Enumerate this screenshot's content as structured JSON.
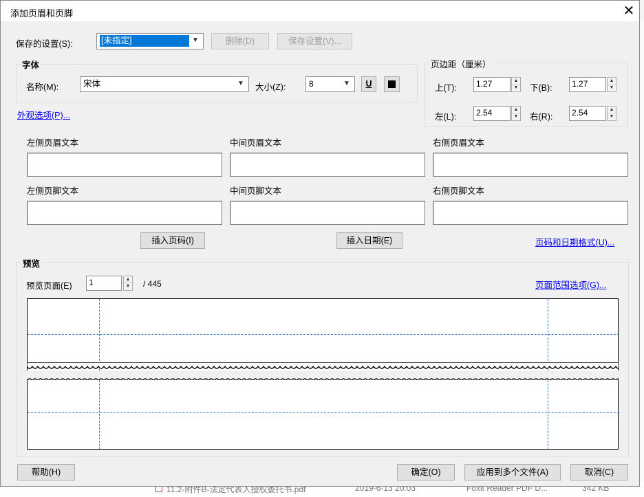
{
  "dialog": {
    "title": "添加页眉和页脚",
    "close_glyph": "✕"
  },
  "saved_settings": {
    "label": "保存的设置(S):",
    "value": "[未指定]",
    "delete_label": "删除(D)",
    "save_label": "保存设置(V)..."
  },
  "font": {
    "group_title": "字体",
    "name_label": "名称(M):",
    "name_value": "宋体",
    "size_label": "大小(Z):",
    "size_value": "8",
    "underline_glyph": "U"
  },
  "appearance_link": "外观选项(P)...",
  "margins": {
    "group_title": "页边距（厘米）",
    "top_label": "上(T):",
    "top_value": "1.27",
    "bottom_label": "下(B):",
    "bottom_value": "1.27",
    "left_label": "左(L):",
    "left_value": "2.54",
    "right_label": "右(R):",
    "right_value": "2.54"
  },
  "header_footer": {
    "left_header_label": "左侧页眉文本",
    "center_header_label": "中间页眉文本",
    "right_header_label": "右侧页眉文本",
    "left_footer_label": "左侧页脚文本",
    "center_footer_label": "中间页脚文本",
    "right_footer_label": "右侧页脚文本",
    "insert_page_label": "插入页码(I)",
    "insert_date_label": "插入日期(E)",
    "format_link": "页码和日期格式(U)..."
  },
  "preview": {
    "group_title": "预览",
    "page_label": "预览页面(E)",
    "page_value": "1",
    "total": "/ 445",
    "range_link": "页面范围选项(G)..."
  },
  "footer_buttons": {
    "help": "帮助(H)",
    "ok": "确定(O)",
    "apply_multiple": "应用到多个文件(A)",
    "cancel": "取消(C)"
  },
  "background": {
    "file_name": "11.2-附件B-法定代表人授权委托书.pdf",
    "file_date": "2019-6-13 20:03",
    "file_type": "Foxit Reader PDF D...",
    "file_size": "342 KB"
  },
  "colors": {
    "accent_selection": "#0078d7",
    "link": "#0000ee",
    "guide_line": "#3b78c9"
  },
  "icons": {
    "dropdown": "chevron-down-icon",
    "spin_up": "triangle-up-icon",
    "spin_down": "triangle-down-icon",
    "close": "close-icon",
    "color_swatch": "black-square-icon",
    "underline": "underline-icon"
  }
}
